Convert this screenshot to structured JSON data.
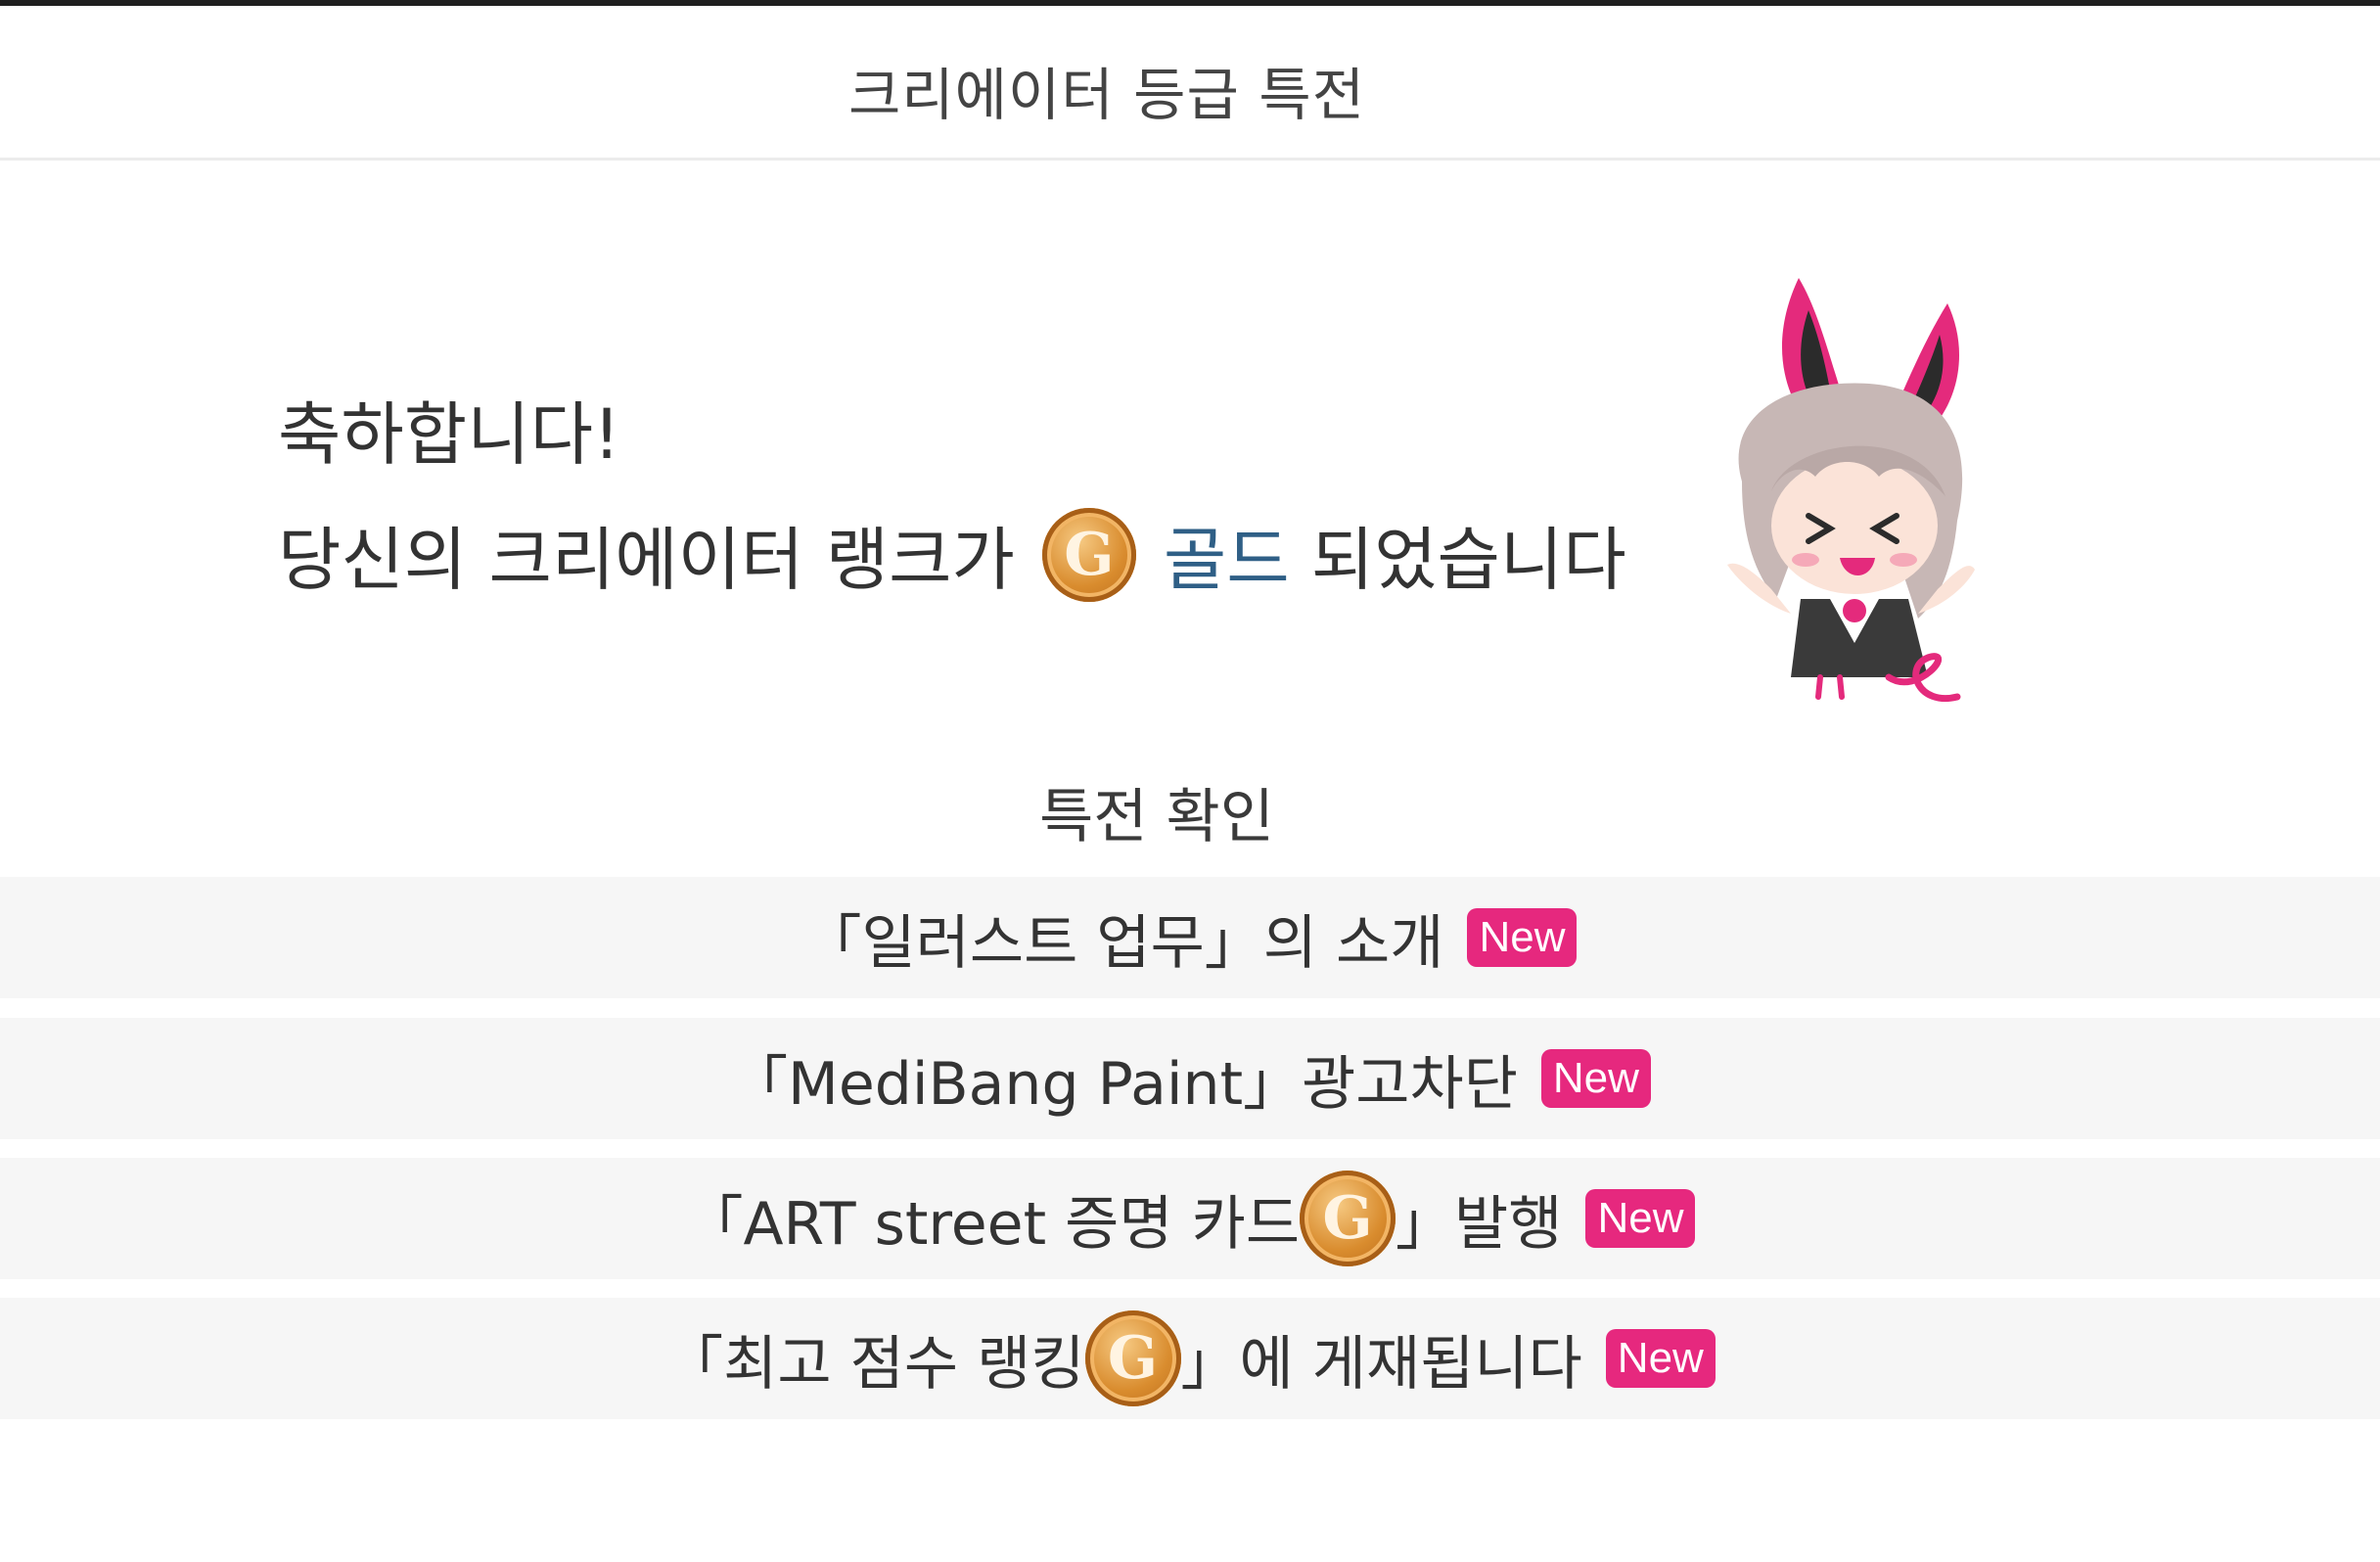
{
  "header": {
    "title": "크리에이터 등급 특전"
  },
  "congrats": {
    "line1": "축하합니다!",
    "line2_prefix": "당신의 크리에이터 랭크가",
    "rank_coin_letter": "G",
    "rank_name": "골드",
    "line2_suffix": "되었습니다"
  },
  "perks_section": {
    "title": "특전 확인"
  },
  "perks": [
    {
      "text": "「일러스트 업무」의 소개",
      "badge": "New"
    },
    {
      "text": "「MediBang Paint」광고차단",
      "badge": "New"
    },
    {
      "text_before": "「ART street 증명 카드",
      "coin_letter": "G",
      "text_after": "」발행",
      "badge": "New"
    },
    {
      "text_before": "「최고 점수 랭킹",
      "coin_letter": "G",
      "text_after": "」에 게재됩니다",
      "badge": "New"
    }
  ],
  "colors": {
    "accent": "#e6287e",
    "rank_text": "#2f5f86",
    "coin": "#d98c2e"
  },
  "icons": {
    "rank_coin": "gold-coin-icon",
    "mascot": "mascot-character"
  }
}
